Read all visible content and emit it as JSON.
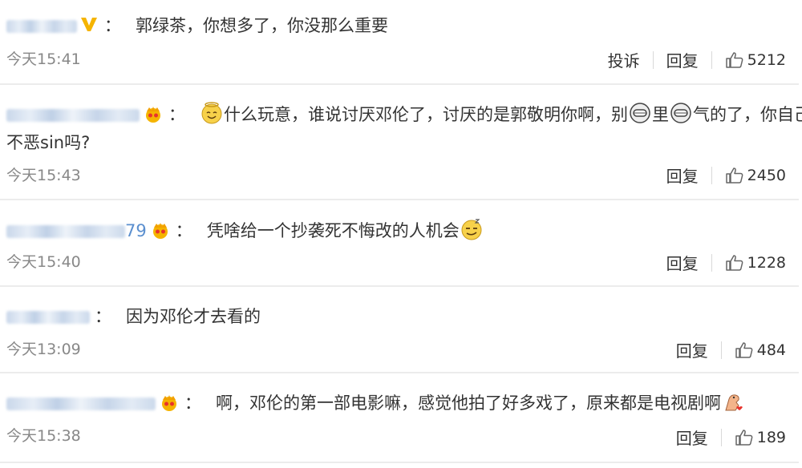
{
  "comments": [
    {
      "separator": "：",
      "text": "郭绿茶，你想多了，你没那么重要",
      "time": "今天15:41",
      "report_label": "投诉",
      "reply_label": "回复",
      "likes": "5212"
    },
    {
      "separator": "：",
      "text_part1": "什么玩意，谁说讨厌邓伦了，讨厌的是郭敬明你啊，别",
      "text_part2": "里",
      "text_part3": "气的了，你自己",
      "text_line2": "不恶sin吗?",
      "time": "今天15:43",
      "reply_label": "回复",
      "likes": "2450"
    },
    {
      "name_visible": "79",
      "separator": "：",
      "text": "凭啥给一个抄袭死不悔改的人机会",
      "time": "今天15:40",
      "reply_label": "回复",
      "likes": "1228"
    },
    {
      "separator": "：",
      "text": "因为邓伦才去看的",
      "time": "今天13:09",
      "reply_label": "回复",
      "likes": "484"
    },
    {
      "separator": "：",
      "text": "啊，邓伦的第一部电影嘛，感觉他拍了好多戏了，原来都是电视剧啊",
      "time": "今天15:38",
      "reply_label": "回复",
      "likes": "189"
    }
  ],
  "icons": {
    "verified": "verified-v-icon",
    "crown": "vip-crown-icon",
    "like": "thumbs-up-icon",
    "emoji_angel": "halo-smile-emoji",
    "emoji_lips": "lips-emoji",
    "emoji_smug": "smug-emoji",
    "emoji_bow": "bow-emoji"
  },
  "colors": {
    "username": "#5b8fcf",
    "text": "#333333",
    "time": "#888888",
    "divider": "#ececec",
    "badge_gold": "#f5b400"
  }
}
